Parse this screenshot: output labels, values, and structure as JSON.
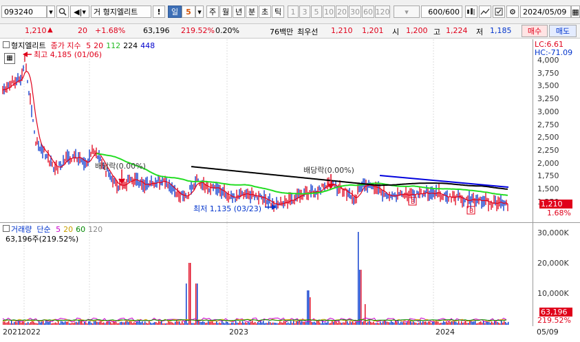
{
  "toolbar": {
    "code": "093240",
    "search_icon": "magnifier-icon",
    "speaker_icon": "speaker-icon",
    "stock_prefix": "거",
    "stock_name": "형지엘리트",
    "warn": "!",
    "period_selected": "일",
    "period_value": "5",
    "periods": [
      "주",
      "월",
      "년",
      "분",
      "초",
      "틱"
    ],
    "minute_options": [
      "1",
      "3",
      "5",
      "10",
      "20",
      "30",
      "60",
      "120"
    ],
    "count": "600/600",
    "date": "2024/05/09"
  },
  "quote": {
    "price": "1,210",
    "change": "20",
    "change_pct": "+1.68%",
    "volume": "63,196",
    "volume_ratio": "219.52%",
    "turnover": "0.20%",
    "cap_label": "76백만",
    "best_label": "최우선",
    "ask": "1,210",
    "bid": "1,201",
    "open_label": "시",
    "open": "1,200",
    "high_label": "고",
    "high": "1,224",
    "low_label": "저",
    "low": "1,185",
    "buy_button": "매수",
    "sell_button": "매도"
  },
  "price_panel": {
    "title": "형지엘리트",
    "ma_label": "종가 지수",
    "ma_periods": [
      {
        "label": "5",
        "color": "#e0001a"
      },
      {
        "label": "20",
        "color": "#e0001a"
      },
      {
        "label": "112",
        "color": "#22bb22"
      },
      {
        "label": "224",
        "color": "#000000"
      },
      {
        "label": "448",
        "color": "#0000cc"
      }
    ],
    "lc": "LC:6.61",
    "hc": "HC:-71.09",
    "high_annotation": "최고 4,185 (01/06)",
    "low_annotation": "최저 1,135 (03/23)",
    "dividend_1": "배당락(0.00%)",
    "dividend_2": "배당락(0.00%)",
    "b_marker": "B",
    "current_price": "1,210",
    "current_pct": "1.68%",
    "y_ticks": [
      "4,000",
      "3,750",
      "3,500",
      "3,250",
      "3,000",
      "2,750",
      "2,500",
      "2,250",
      "2,000",
      "1,750",
      "1,500",
      "1,250"
    ]
  },
  "volume_panel": {
    "title": "거래량",
    "ma_label": "단순",
    "ma_periods": [
      {
        "label": "5",
        "color": "#cc00cc"
      },
      {
        "label": "20",
        "color": "#c8a000"
      },
      {
        "label": "60",
        "color": "#008800"
      },
      {
        "label": "120",
        "color": "#888888"
      }
    ],
    "info": "63,196주(219.52%)",
    "y_ticks": [
      "30,000K",
      "20,000K",
      "10,000K"
    ],
    "current_volume": "63,196",
    "current_pct": "219.52%"
  },
  "x_axis": {
    "labels": [
      "2021",
      "2022",
      "2023",
      "2024"
    ],
    "last_date": "05/09"
  },
  "colors": {
    "up": "#e0001a",
    "down": "#0033cc",
    "ma112": "#22bb22",
    "ma224": "#000000",
    "trend": "#0000cc"
  }
}
